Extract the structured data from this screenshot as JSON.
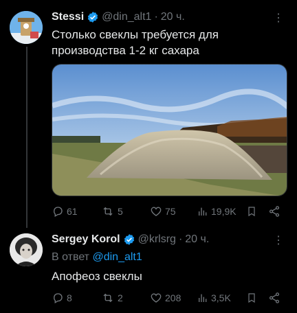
{
  "tweets": [
    {
      "name": "Stessi",
      "handle": "@din_alt1",
      "sep": "·",
      "time": "20 ч.",
      "text_lines": [
        "Столько свеклы требуется для",
        "производства 1-2 кг сахара"
      ],
      "stats": {
        "replies": "61",
        "retweets": "5",
        "likes": "75",
        "views": "19,9K"
      }
    },
    {
      "name": "Sergey Korol",
      "handle": "@krlsrg",
      "sep": "·",
      "time": "20 ч.",
      "reply_prefix": "В ответ",
      "reply_to": "@din_alt1",
      "text": "Апофеоз свеклы",
      "stats": {
        "replies": "8",
        "retweets": "2",
        "likes": "208",
        "views": "3,5K"
      }
    }
  ],
  "more_glyph": "⋮",
  "icons": [
    "reply-icon",
    "retweet-icon",
    "like-icon",
    "views-icon",
    "bookmark-icon",
    "share-icon",
    "verified-icon",
    "more-icon"
  ],
  "colors": {
    "accent": "#1d9bf0",
    "muted": "#71767b",
    "text": "#e7e9ea",
    "background": "#000000"
  }
}
